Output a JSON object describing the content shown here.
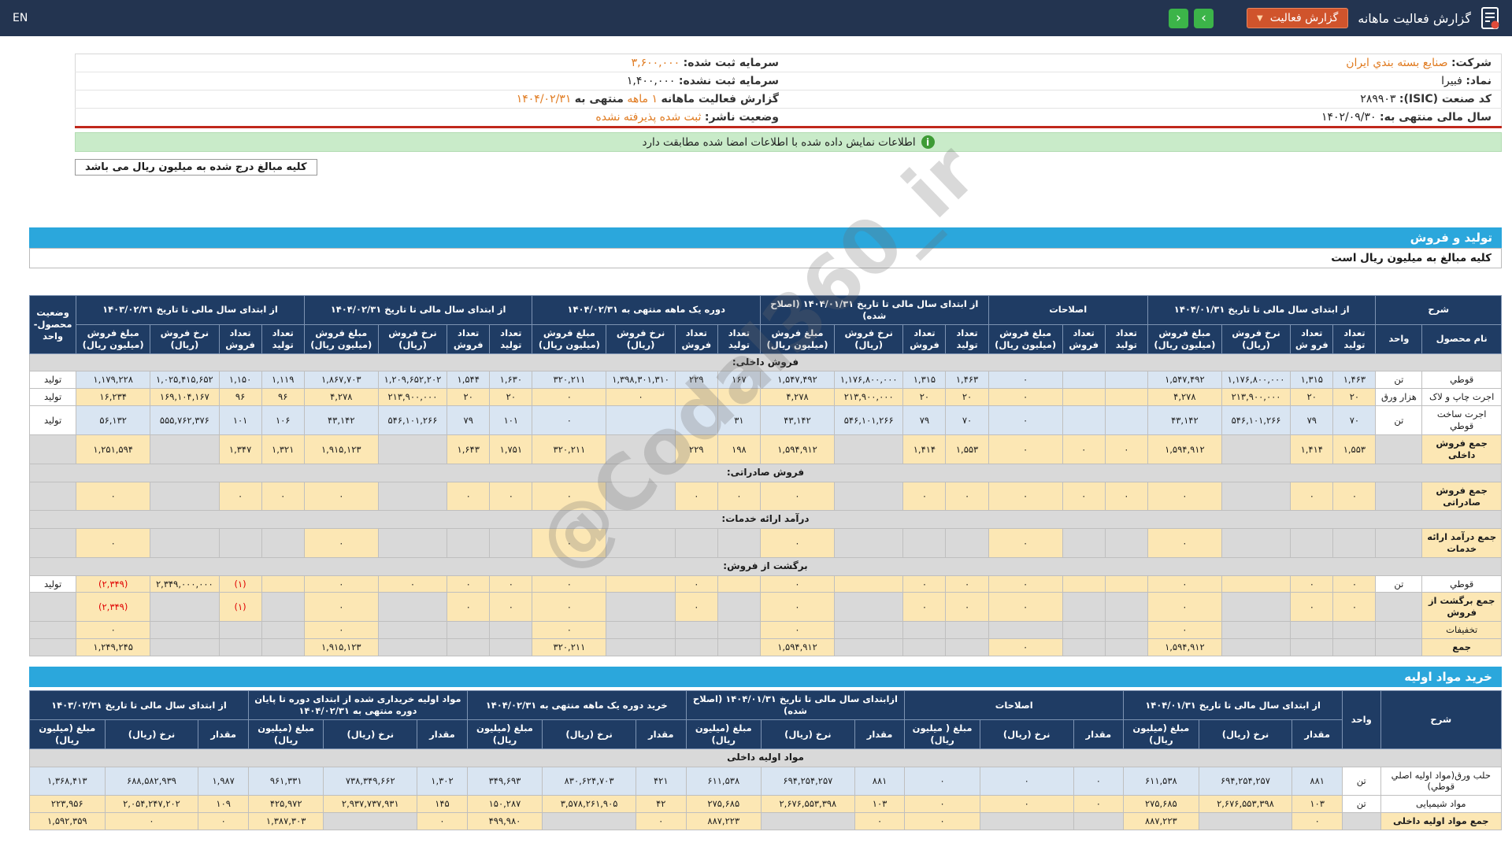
{
  "colors": {
    "topbar_bg": "#233450",
    "accent_orange": "#d0542c",
    "nav_green": "#3cb449",
    "table_header_navy": "#1f3c64",
    "row_blue": "#d9e5f2",
    "row_cream": "#fce7b4",
    "empty_gray": "#d9d9d9",
    "section_blue": "#2ba7dc",
    "notice_green": "#c9ebc9",
    "negative_red": "#e00000",
    "highlight_text": "#e07a1f",
    "red_rule": "#c0281c"
  },
  "topbar": {
    "title": "گزارش فعالیت ماهانه",
    "report_button": "گزارش فعالیت",
    "caret_icon": "▼",
    "next_icon": "›",
    "prev_icon": "‹",
    "en_label": "EN"
  },
  "company": {
    "right": [
      {
        "label": "شرکت:",
        "value": "صنايع بسته بندي ايران"
      },
      {
        "label": "نماد:",
        "value": "فبيرا"
      },
      {
        "label": "کد صنعت (ISIC):",
        "value": "۲۸۹۹۰۳"
      },
      {
        "label": "سال مالی منتهی به:",
        "value": "۱۴۰۲/۰۹/۳۰"
      }
    ],
    "left": [
      {
        "label": "سرمایه ثبت شده:",
        "value": "۳,۶۰۰,۰۰۰"
      },
      {
        "label": "سرمایه ثبت نشده:",
        "value": "۱,۴۰۰,۰۰۰"
      },
      {
        "label": "گزارش فعالیت ماهانه",
        "value": "۱ ماهه",
        "mid": "منتهی به",
        "value2": "۱۴۰۴/۰۲/۳۱"
      },
      {
        "label": "وضعیت ناشر:",
        "value": "ثبت شده پذیرفته نشده"
      }
    ]
  },
  "notes": {
    "info_icon": "i",
    "signature_match": "اطلاعات نمایش داده شده با اطلاعات امضا شده مطابقت دارد",
    "amounts_note": "کلیه مبالغ درج شده به میلیون ریال می باشد"
  },
  "watermark": "@Codal360_ir",
  "production_sales": {
    "title": "تولید و فروش",
    "note": "کلیه مبالغ به میلیون ریال است",
    "groups": [
      {
        "label": "شرح",
        "cols": [
          "نام محصول",
          "واحد"
        ]
      },
      {
        "label": "از ابتدای سال مالی تا تاریخ ۱۴۰۴/۰۱/۳۱",
        "cols": [
          "تعداد تولید",
          "تعداد فرو ش",
          "نرخ فروش (ریال)",
          "مبلغ فروش (میلیون ریال)"
        ]
      },
      {
        "label": "اصلاحات",
        "cols": [
          "تعداد تولید",
          "تعداد فروش",
          "مبلغ فروش (میلیون ریال)"
        ]
      },
      {
        "label": "از ابتدای سال مالی تا تاریخ ۱۴۰۴/۰۱/۳۱ (اصلاح شده)",
        "cols": [
          "تعداد تولید",
          "تعداد فروش",
          "نرخ فروش (ریال)",
          "مبلغ فروش (میلیون ریال)"
        ]
      },
      {
        "label": "دوره یک ماهه منتهی به ۱۴۰۴/۰۲/۳۱",
        "cols": [
          "تعداد تولید",
          "تعداد فروش",
          "نرخ فروش (ریال)",
          "مبلغ فروش (میلیون ریال)"
        ]
      },
      {
        "label": "از ابتدای سال مالی تا تاریخ ۱۴۰۴/۰۲/۳۱",
        "cols": [
          "تعداد تولید",
          "تعداد فروش",
          "نرخ فروش (ریال)",
          "مبلغ فروش (میلیون ریال)"
        ]
      },
      {
        "label": "از ابتدای سال مالی تا تاریخ ۱۴۰۳/۰۲/۳۱",
        "cols": [
          "تعداد تولید",
          "تعداد فروش",
          "نرخ فروش (ریال)",
          "مبلغ فروش (میلیون ریال)"
        ]
      },
      {
        "label": "وضعیت محصول-واحد",
        "cols": []
      }
    ],
    "rows": [
      {
        "t": "s",
        "label": "فروش داخلی:"
      },
      {
        "t": "d",
        "sh": "b",
        "cells": [
          "قوطي",
          "تن",
          "۱,۴۶۳",
          "۱,۳۱۵",
          "۱,۱۷۶,۸۰۰,۰۰۰",
          "۱,۵۴۷,۴۹۲",
          "",
          "",
          "۰",
          "۱,۴۶۳",
          "۱,۳۱۵",
          "۱,۱۷۶,۸۰۰,۰۰۰",
          "۱,۵۴۷,۴۹۲",
          "۱۶۷",
          "۲۲۹",
          "۱,۳۹۸,۳۰۱,۳۱۰",
          "۳۲۰,۲۱۱",
          "۱,۶۳۰",
          "۱,۵۴۴",
          "۱,۲۰۹,۶۵۲,۲۰۲",
          "۱,۸۶۷,۷۰۳",
          "۱,۱۱۹",
          "۱,۱۵۰",
          "۱,۰۲۵,۴۱۵,۶۵۲",
          "۱,۱۷۹,۲۲۸",
          "تولید"
        ]
      },
      {
        "t": "d",
        "sh": "c",
        "cells": [
          "اجرت چاپ و لاک",
          "هزار ورق",
          "۲۰",
          "۲۰",
          "۲۱۳,۹۰۰,۰۰۰",
          "۴,۲۷۸",
          "",
          "",
          "۰",
          "۲۰",
          "۲۰",
          "۲۱۳,۹۰۰,۰۰۰",
          "۴,۲۷۸",
          "",
          "",
          "۰",
          "۰",
          "۲۰",
          "۲۰",
          "۲۱۳,۹۰۰,۰۰۰",
          "۴,۲۷۸",
          "۹۶",
          "۹۶",
          "۱۶۹,۱۰۴,۱۶۷",
          "۱۶,۲۳۴",
          "تولید"
        ]
      },
      {
        "t": "d",
        "sh": "b",
        "cells": [
          "اجرت ساخت قوطي",
          "تن",
          "۷۰",
          "۷۹",
          "۵۴۶,۱۰۱,۲۶۶",
          "۴۳,۱۴۲",
          "",
          "",
          "۰",
          "۷۰",
          "۷۹",
          "۵۴۶,۱۰۱,۲۶۶",
          "۴۳,۱۴۲",
          "۳۱",
          "",
          "",
          "۰",
          "۱۰۱",
          "۷۹",
          "۵۴۶,۱۰۱,۲۶۶",
          "۴۳,۱۴۲",
          "۱۰۶",
          "۱۰۱",
          "۵۵۵,۷۶۲,۳۷۶",
          "۵۶,۱۳۲",
          "تولید"
        ]
      },
      {
        "t": "d",
        "sh": "c",
        "b": 1,
        "cells": [
          "جمع فروش داخلی",
          "",
          "۱,۵۵۳",
          "۱,۴۱۴",
          "",
          "۱,۵۹۴,۹۱۲",
          "۰",
          "۰",
          "۰",
          "۱,۵۵۳",
          "۱,۴۱۴",
          "",
          "۱,۵۹۴,۹۱۲",
          "۱۹۸",
          "۲۲۹",
          "",
          "۳۲۰,۲۱۱",
          "۱,۷۵۱",
          "۱,۶۴۳",
          "",
          "۱,۹۱۵,۱۲۳",
          "۱,۳۲۱",
          "۱,۳۴۷",
          "",
          "۱,۲۵۱,۵۹۴",
          ""
        ]
      },
      {
        "t": "s",
        "label": "فروش صادراتی:"
      },
      {
        "t": "d",
        "sh": "c",
        "b": 1,
        "cells": [
          "جمع فروش صادراتی",
          "",
          "۰",
          "۰",
          "",
          "۰",
          "۰",
          "۰",
          "۰",
          "۰",
          "۰",
          "",
          "۰",
          "۰",
          "۰",
          "",
          "۰",
          "۰",
          "۰",
          "",
          "۰",
          "۰",
          "۰",
          "",
          "۰",
          ""
        ]
      },
      {
        "t": "s",
        "label": "درآمد ارائه خدمات:"
      },
      {
        "t": "d",
        "sh": "c",
        "b": 1,
        "cells": [
          "جمع درآمد ارائه خدمات",
          "",
          "",
          "",
          "",
          "۰",
          "",
          "",
          "۰",
          "",
          "",
          "",
          "۰",
          "",
          "",
          "",
          "۰",
          "",
          "",
          "",
          "۰",
          "",
          "",
          "",
          "۰",
          ""
        ]
      },
      {
        "t": "s",
        "label": "برگشت از فروش:"
      },
      {
        "t": "d",
        "sh": "c",
        "cells": [
          "قوطي",
          "تن",
          "۰",
          "۰",
          "",
          "۰",
          "",
          "",
          "۰",
          "۰",
          "۰",
          "",
          "۰",
          "",
          "۰",
          "",
          "۰",
          "۰",
          "۰",
          "۰",
          "۰",
          "",
          "(۱)",
          "۲,۳۴۹,۰۰۰,۰۰۰",
          "(۲,۳۴۹)",
          "تولید"
        ]
      },
      {
        "t": "d",
        "sh": "c",
        "b": 1,
        "cells": [
          "جمع برگشت از فروش",
          "",
          "۰",
          "۰",
          "",
          "۰",
          "",
          "",
          "۰",
          "۰",
          "۰",
          "",
          "۰",
          "",
          "۰",
          "",
          "۰",
          "۰",
          "۰",
          "",
          "۰",
          "",
          "(۱)",
          "",
          "(۲,۳۴۹)",
          ""
        ]
      },
      {
        "t": "d",
        "sh": "c",
        "cells": [
          "تخفیفات",
          "",
          "",
          "",
          "",
          "۰",
          "",
          "",
          "",
          "",
          "",
          "",
          "۰",
          "",
          "",
          "",
          "۰",
          "",
          "",
          "",
          "۰",
          "",
          "",
          "",
          "۰",
          ""
        ]
      },
      {
        "t": "d",
        "sh": "c",
        "b": 1,
        "cells": [
          "جمع",
          "",
          "",
          "",
          "",
          "۱,۵۹۴,۹۱۲",
          "",
          "",
          "۰",
          "",
          "",
          "",
          "۱,۵۹۴,۹۱۲",
          "",
          "",
          "",
          "۳۲۰,۲۱۱",
          "",
          "",
          "",
          "۱,۹۱۵,۱۲۳",
          "",
          "",
          "",
          "۱,۲۴۹,۲۴۵",
          ""
        ]
      }
    ]
  },
  "raw_materials": {
    "title": "خرید مواد اولیه",
    "groups": [
      {
        "label": "شرح",
        "cols": []
      },
      {
        "label": "واحد",
        "cols": []
      },
      {
        "label": "از ابتدای سال مالی تا تاریخ ۱۴۰۴/۰۱/۳۱",
        "cols": [
          "مقدار",
          "نرخ (ریال)",
          "مبلغ (میلیون ریال)"
        ]
      },
      {
        "label": "اصلاحات",
        "cols": [
          "مقدار",
          "نرخ (ریال)",
          "مبلغ ( میلیون ریال)"
        ]
      },
      {
        "label": "ازابتدای سال مالی تا تاریخ ۱۴۰۴/۰۱/۳۱ (اصلاح شده)",
        "cols": [
          "مقدار",
          "نرخ (ریال)",
          "مبلغ (میلیون ریال)"
        ]
      },
      {
        "label": "خرید دوره یک ماهه منتهی به ۱۴۰۴/۰۲/۳۱",
        "cols": [
          "مقدار",
          "نرخ (ریال)",
          "مبلغ (میلیون ریال)"
        ]
      },
      {
        "label": "مواد اولیه خریداری شده از ابتدای دوره تا پایان دوره منتهی به ۱۴۰۴/۰۲/۳۱",
        "cols": [
          "مقدار",
          "نرخ (ریال)",
          "مبلغ (میلیون ریال)"
        ]
      },
      {
        "label": "از ابتدای سال مالی تا تاریخ ۱۴۰۳/۰۲/۳۱",
        "cols": [
          "مقدار",
          "نرخ (ریال)",
          "مبلغ (میلیون ریال)"
        ]
      }
    ],
    "rows": [
      {
        "t": "s",
        "label": "مواد اولیه داخلی"
      },
      {
        "t": "d",
        "sh": "b",
        "cells": [
          "حلب ورق(مواد اولیه اصلي قوطي)",
          "تن",
          "۸۸۱",
          "۶۹۴,۲۵۴,۲۵۷",
          "۶۱۱,۵۳۸",
          "۰",
          "۰",
          "۰",
          "۸۸۱",
          "۶۹۴,۲۵۴,۲۵۷",
          "۶۱۱,۵۳۸",
          "۴۲۱",
          "۸۳۰,۶۲۴,۷۰۳",
          "۳۴۹,۶۹۳",
          "۱,۳۰۲",
          "۷۳۸,۳۴۹,۶۶۲",
          "۹۶۱,۳۳۱",
          "۱,۹۸۷",
          "۶۸۸,۵۸۲,۹۳۹",
          "۱,۳۶۸,۴۱۳"
        ]
      },
      {
        "t": "d",
        "sh": "c",
        "cells": [
          "مواد شیمیایی",
          "تن",
          "۱۰۳",
          "۲,۶۷۶,۵۵۳,۳۹۸",
          "۲۷۵,۶۸۵",
          "۰",
          "۰",
          "۰",
          "۱۰۳",
          "۲,۶۷۶,۵۵۳,۳۹۸",
          "۲۷۵,۶۸۵",
          "۴۲",
          "۳,۵۷۸,۲۶۱,۹۰۵",
          "۱۵۰,۲۸۷",
          "۱۴۵",
          "۲,۹۳۷,۷۳۷,۹۳۱",
          "۴۲۵,۹۷۲",
          "۱۰۹",
          "۲,۰۵۴,۲۴۷,۲۰۲",
          "۲۲۳,۹۵۶"
        ]
      },
      {
        "t": "d",
        "sh": "c",
        "b": 1,
        "cells": [
          "جمع مواد اولیه داخلی",
          "",
          "۰",
          "",
          "۸۸۷,۲۲۳",
          "",
          "",
          "۰",
          "۰",
          "",
          "۸۸۷,۲۲۳",
          "۰",
          "",
          "۴۹۹,۹۸۰",
          "۰",
          "",
          "۱,۳۸۷,۳۰۳",
          "۰",
          "۰",
          "۱,۵۹۲,۳۵۹"
        ]
      }
    ]
  }
}
